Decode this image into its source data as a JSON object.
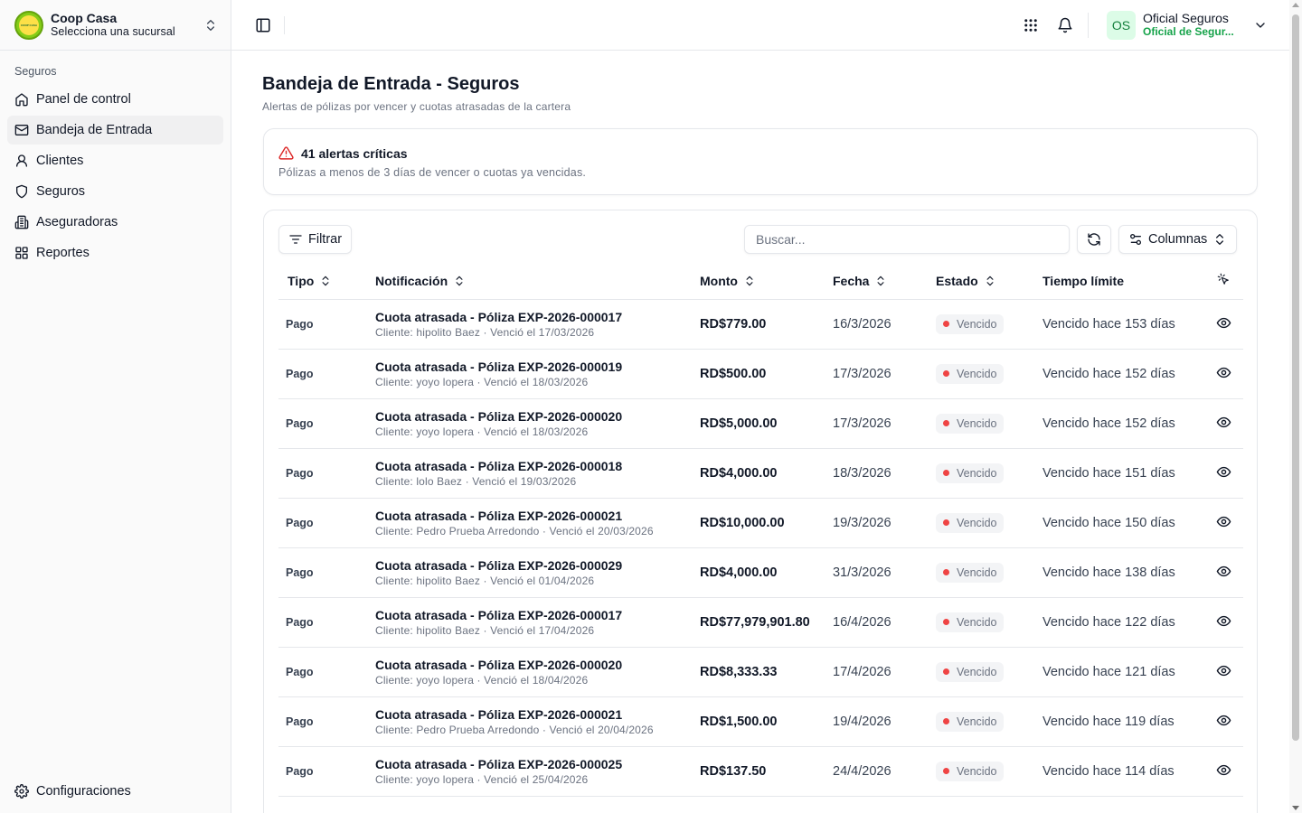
{
  "brand": {
    "name": "Coop Casa",
    "subtitle": "Selecciona una sucursal",
    "logo_text": "COOP CASA"
  },
  "sidebar": {
    "group_label": "Seguros",
    "items": [
      {
        "label": "Panel de control",
        "icon": "home-icon"
      },
      {
        "label": "Bandeja de Entrada",
        "icon": "mail-icon",
        "active": true
      },
      {
        "label": "Clientes",
        "icon": "user-icon"
      },
      {
        "label": "Seguros",
        "icon": "shield-icon"
      },
      {
        "label": "Aseguradoras",
        "icon": "building-icon"
      },
      {
        "label": "Reportes",
        "icon": "grid-icon"
      }
    ],
    "settings_label": "Configuraciones"
  },
  "header": {
    "user": {
      "initials": "OS",
      "name": "Oficial Seguros",
      "role": "Oficial de Segur..."
    }
  },
  "page": {
    "title": "Bandeja de Entrada - Seguros",
    "subtitle": "Alertas de pólizas por vencer y cuotas atrasadas de la cartera"
  },
  "alert": {
    "title": "41 alertas críticas",
    "description": "Pólizas a menos de 3 días de vencer o cuotas ya vencidas."
  },
  "toolbar": {
    "filter_label": "Filtrar",
    "search_placeholder": "Buscar...",
    "columns_label": "Columnas"
  },
  "table": {
    "headers": {
      "tipo": "Tipo",
      "notificacion": "Notificación",
      "monto": "Monto",
      "fecha": "Fecha",
      "estado": "Estado",
      "tiempo": "Tiempo límite"
    },
    "rows": [
      {
        "tipo": "Pago",
        "title": "Cuota atrasada - Póliza EXP-2026-000017",
        "sub": "Cliente: hipolito Baez · Venció el 17/03/2026",
        "monto": "RD$779.00",
        "fecha": "16/3/2026",
        "estado": "Vencido",
        "tiempo": "Vencido hace 153 días"
      },
      {
        "tipo": "Pago",
        "title": "Cuota atrasada - Póliza EXP-2026-000019",
        "sub": "Cliente: yoyo lopera · Venció el 18/03/2026",
        "monto": "RD$500.00",
        "fecha": "17/3/2026",
        "estado": "Vencido",
        "tiempo": "Vencido hace 152 días"
      },
      {
        "tipo": "Pago",
        "title": "Cuota atrasada - Póliza EXP-2026-000020",
        "sub": "Cliente: yoyo lopera · Venció el 18/03/2026",
        "monto": "RD$5,000.00",
        "fecha": "17/3/2026",
        "estado": "Vencido",
        "tiempo": "Vencido hace 152 días"
      },
      {
        "tipo": "Pago",
        "title": "Cuota atrasada - Póliza EXP-2026-000018",
        "sub": "Cliente: lolo Baez · Venció el 19/03/2026",
        "monto": "RD$4,000.00",
        "fecha": "18/3/2026",
        "estado": "Vencido",
        "tiempo": "Vencido hace 151 días"
      },
      {
        "tipo": "Pago",
        "title": "Cuota atrasada - Póliza EXP-2026-000021",
        "sub": "Cliente: Pedro Prueba Arredondo · Venció el 20/03/2026",
        "monto": "RD$10,000.00",
        "fecha": "19/3/2026",
        "estado": "Vencido",
        "tiempo": "Vencido hace 150 días"
      },
      {
        "tipo": "Pago",
        "title": "Cuota atrasada - Póliza EXP-2026-000029",
        "sub": "Cliente: hipolito Baez · Venció el 01/04/2026",
        "monto": "RD$4,000.00",
        "fecha": "31/3/2026",
        "estado": "Vencido",
        "tiempo": "Vencido hace 138 días"
      },
      {
        "tipo": "Pago",
        "title": "Cuota atrasada - Póliza EXP-2026-000017",
        "sub": "Cliente: hipolito Baez · Venció el 17/04/2026",
        "monto": "RD$77,979,901.80",
        "fecha": "16/4/2026",
        "estado": "Vencido",
        "tiempo": "Vencido hace 122 días"
      },
      {
        "tipo": "Pago",
        "title": "Cuota atrasada - Póliza EXP-2026-000020",
        "sub": "Cliente: yoyo lopera · Venció el 18/04/2026",
        "monto": "RD$8,333.33",
        "fecha": "17/4/2026",
        "estado": "Vencido",
        "tiempo": "Vencido hace 121 días"
      },
      {
        "tipo": "Pago",
        "title": "Cuota atrasada - Póliza EXP-2026-000021",
        "sub": "Cliente: Pedro Prueba Arredondo · Venció el 20/04/2026",
        "monto": "RD$1,500.00",
        "fecha": "19/4/2026",
        "estado": "Vencido",
        "tiempo": "Vencido hace 119 días"
      },
      {
        "tipo": "Pago",
        "title": "Cuota atrasada - Póliza EXP-2026-000025",
        "sub": "Cliente: yoyo lopera · Venció el 25/04/2026",
        "monto": "RD$137.50",
        "fecha": "24/4/2026",
        "estado": "Vencido",
        "tiempo": "Vencido hace 114 días"
      }
    ]
  },
  "colors": {
    "accent_green": "#16a34a",
    "status_red": "#ef4444",
    "alert_red": "#dc2626"
  }
}
